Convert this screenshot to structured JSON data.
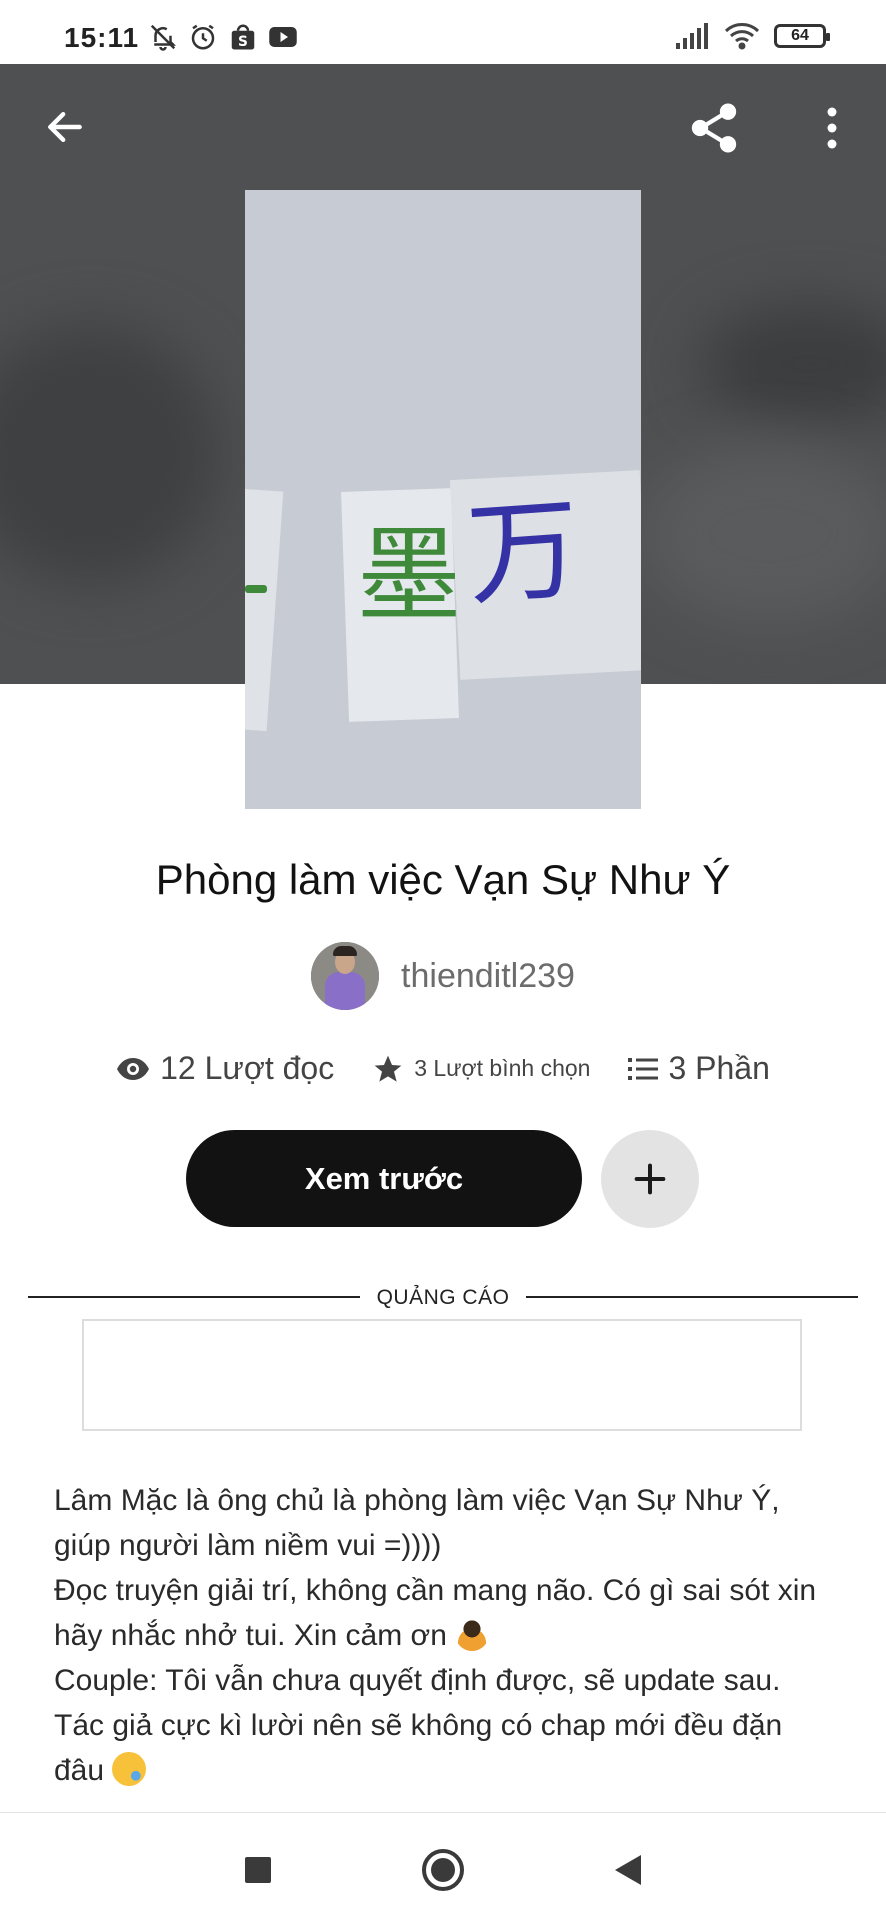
{
  "status_bar": {
    "time": "15:11",
    "battery": "64",
    "left_icons": [
      "bell-off-icon",
      "alarm-icon",
      "shopping-bag-icon",
      "youtube-icon"
    ],
    "right_icons": [
      "signal-icon",
      "wifi-icon",
      "battery-icon"
    ]
  },
  "header": {
    "back_icon": "arrow-left-icon",
    "share_icon": "share-icon",
    "more_icon": "more-vertical-icon",
    "background_color": "#4f5052"
  },
  "cover": {
    "characters": [
      "墨",
      "万"
    ],
    "background_color": "#c7cbd3"
  },
  "story": {
    "title": "Phòng làm việc Vạn Sự Như Ý",
    "author": "thienditl239"
  },
  "stats": {
    "reads": "12 Lượt đọc",
    "votes": "3 Lượt bình chọn",
    "parts": "3 Phần"
  },
  "actions": {
    "preview_label": "Xem trước",
    "add_icon": "plus-icon"
  },
  "ad": {
    "label": "QUẢNG CÁO"
  },
  "description": {
    "line1": "Lâm Mặc là ông chủ là phòng làm việc Vạn Sự Như Ý, giúp người làm niềm vui =))))",
    "line2": "Đọc truyện giải trí, không cần mang não. Có gì sai sót xin hãy nhắc nhở tui. Xin cảm ơn",
    "line3": "Couple: Tôi vẫn chưa quyết định được, sẽ update sau.",
    "line4": "Tác giả cực kì lười nên sẽ không có chap mới đều đặn đâu"
  },
  "nav": {
    "recents_icon": "square-icon",
    "home_icon": "circle-icon",
    "back_icon": "triangle-back-icon"
  }
}
